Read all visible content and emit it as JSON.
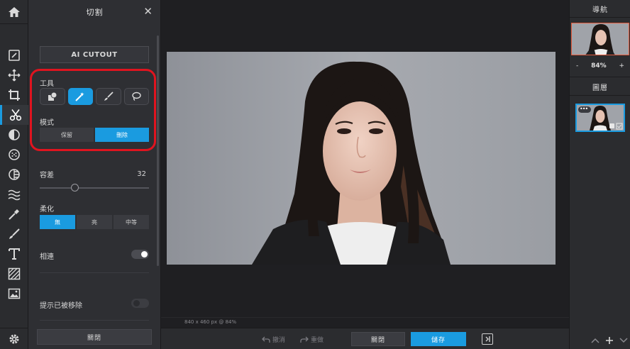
{
  "toolbar": {
    "home_icon": "home-icon",
    "tools": [
      "adjust-icon",
      "move-icon",
      "crop-icon",
      "cut-icon",
      "filter-icon",
      "effects-icon",
      "liquify-icon",
      "waves-icon",
      "dropper-icon",
      "brush-icon",
      "text-icon",
      "texture-icon",
      "image-icon"
    ],
    "active_tool": "cut-icon",
    "settings_icon": "gear-icon"
  },
  "panel": {
    "title": "切割",
    "close_glyph": "✕",
    "ai_cutout_label": "AI CUTOUT",
    "tool_label": "工具",
    "tools": [
      "shape-icon",
      "magic-wand-icon",
      "brush-icon",
      "lasso-icon"
    ],
    "selected_tool": "magic-wand-icon",
    "mode_label": "模式",
    "mode_options": [
      "保留",
      "刪除"
    ],
    "mode_selected": "刪除",
    "tolerance_label": "容差",
    "tolerance_value": "32",
    "tolerance_level": 0.32,
    "feather_label": "柔化",
    "feather_options": [
      "無",
      "亮",
      "中等"
    ],
    "feather_selected": "無",
    "contiguous_label": "相連",
    "contiguous_on": true,
    "show_removed_label": "提示已被移除",
    "show_removed_on": false,
    "close_label": "關閉"
  },
  "canvas": {
    "info": "840 x 460 px @ 84%"
  },
  "bottombar": {
    "undo_label": "撤消",
    "redo_label": "重做",
    "close_label": "關閉",
    "save_label": "儲存"
  },
  "rightpanel": {
    "navigator_title": "導航",
    "zoom_minus": "-",
    "zoom_value": "84%",
    "zoom_plus": "+",
    "layers_title": "圖層",
    "layer_menu_glyph": "•••"
  },
  "colors": {
    "accent": "#1a9be0",
    "highlight": "#e0141f",
    "panel_bg": "#2e2f33",
    "toolbar_bg": "#2b2c2f"
  }
}
